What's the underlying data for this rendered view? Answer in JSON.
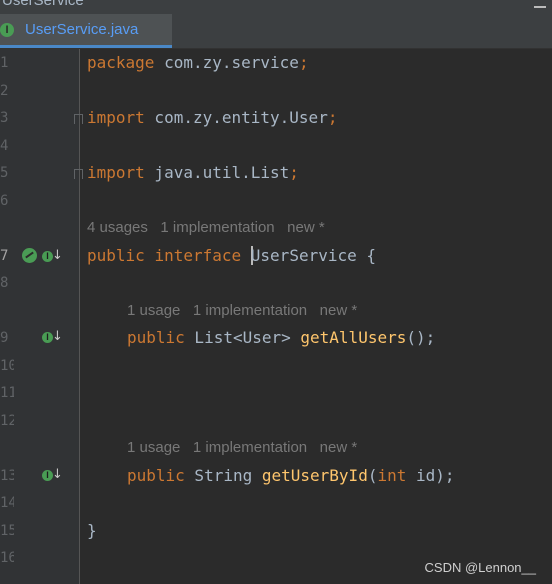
{
  "window": {
    "breadcrumb": "UserService"
  },
  "tab": {
    "label": "UserService.java",
    "icon_letter": "I",
    "icon": "interface-icon"
  },
  "gutter": {
    "line_numbers": [
      "1",
      "2",
      "3",
      "4",
      "5",
      "6",
      "7",
      "8",
      "9",
      "10",
      "11",
      "12",
      "13",
      "14",
      "15",
      "16"
    ]
  },
  "code": {
    "line1": {
      "kw": "package",
      "rest": " com.zy.service",
      "semi": ";"
    },
    "line3": {
      "kw": "import",
      "rest": " com.zy.entity.User",
      "semi": ";"
    },
    "line5": {
      "kw": "import",
      "rest": " java.util.List",
      "semi": ";"
    },
    "hint1": {
      "usages": "4 usages",
      "impl": "1 implementation",
      "author": "new *"
    },
    "line7": {
      "kw1": "public",
      "kw2": "interface",
      "name": "UserService",
      "brace": " {"
    },
    "hint2": {
      "usages": "1 usage",
      "impl": "1 implementation",
      "author": "new *"
    },
    "line9": {
      "kw": "public",
      "type": " List<User> ",
      "method": "getAllUsers",
      "rest": "();"
    },
    "hint3": {
      "usages": "1 usage",
      "impl": "1 implementation",
      "author": "new *"
    },
    "line13": {
      "kw": "public",
      "type": " String ",
      "method": "getUserById",
      "open": "(",
      "argtype": "int",
      "rest": " id);"
    },
    "line15": {
      "brace": "}"
    }
  },
  "watermark": "CSDN @Lennon__",
  "colors": {
    "background": "#2b2b2b",
    "keyword": "#cc7832",
    "plain": "#a9b7c6",
    "method": "#ffc66d",
    "hint": "#787878",
    "tab_text": "#589df6",
    "tab_underline": "#4a88c7",
    "gutter_green": "#499c54"
  }
}
